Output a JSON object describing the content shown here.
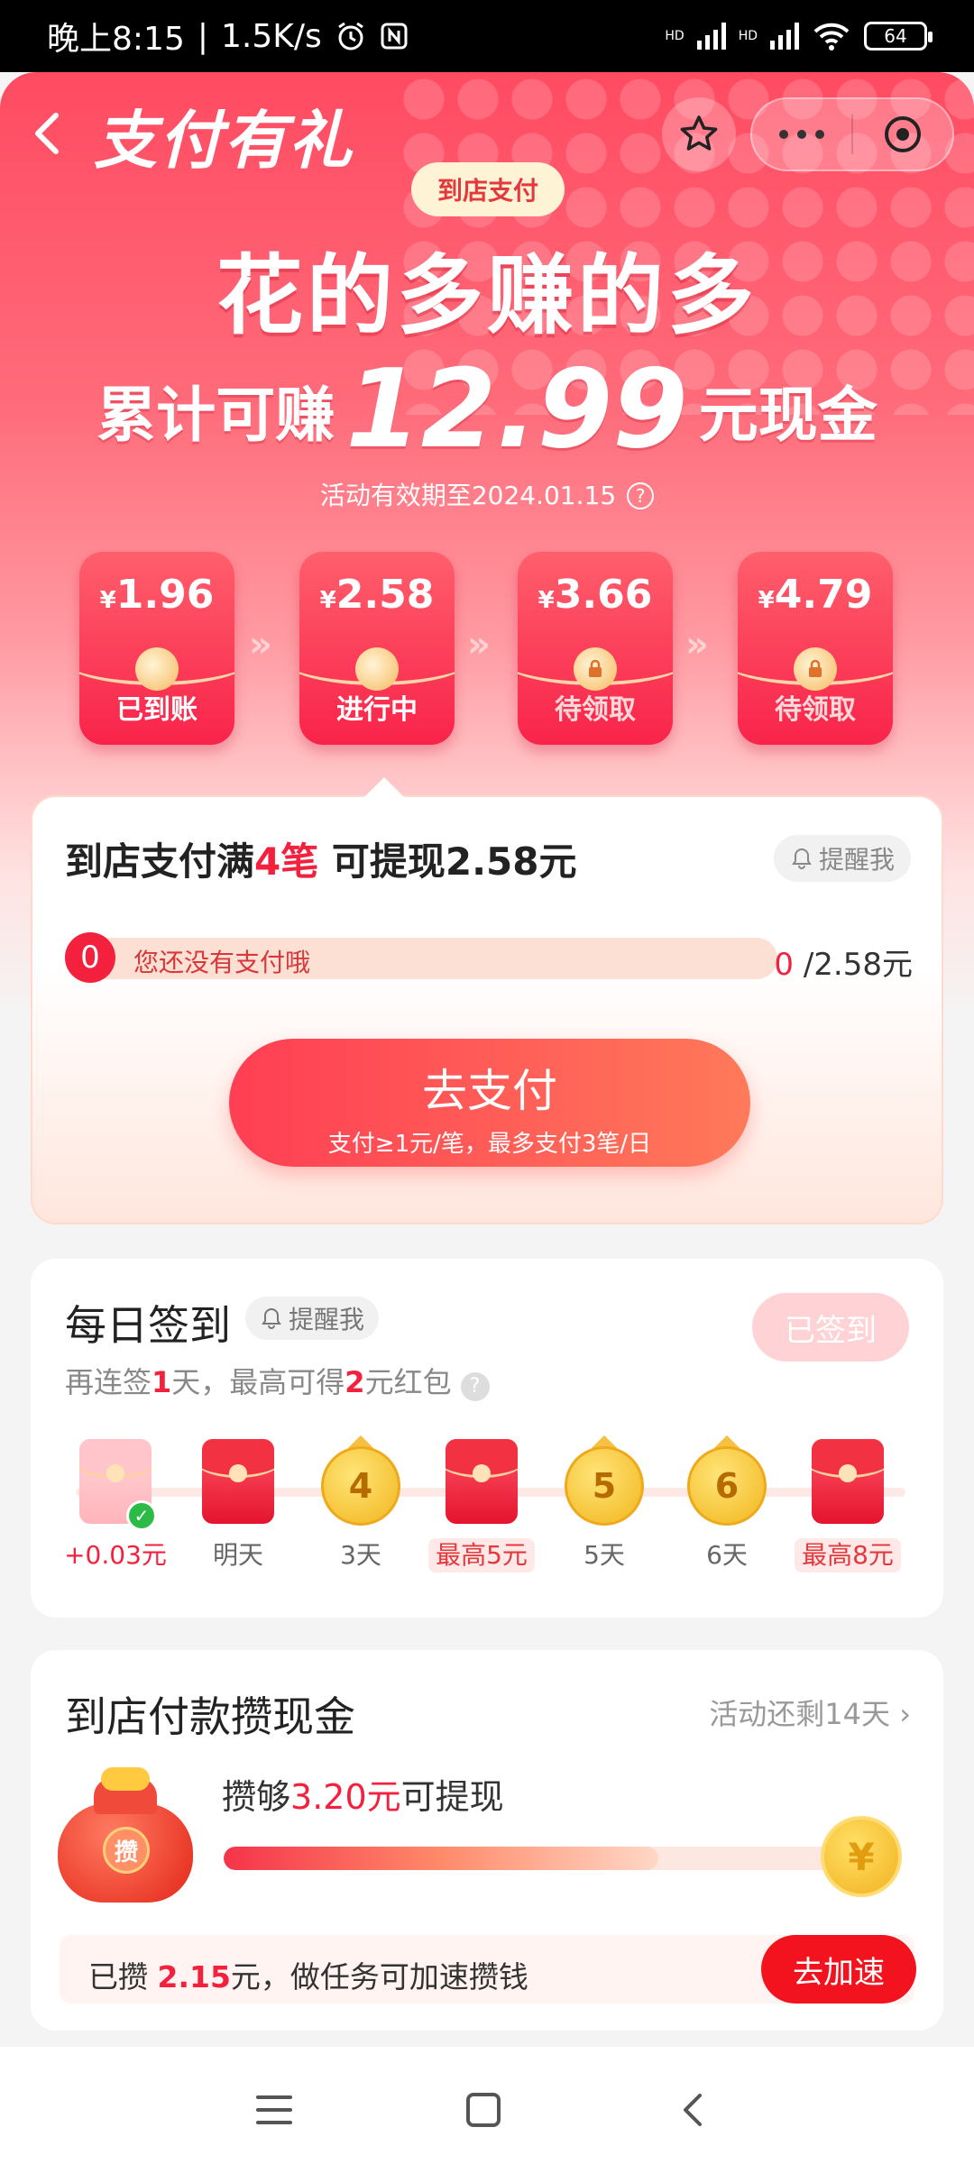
{
  "status_bar": {
    "time": "晚上8:15",
    "separator": "|",
    "speed": "1.5K/s",
    "signal1": "HD",
    "signal2": "HD",
    "battery": "64",
    "icons": [
      "alarm-icon",
      "nfc-icon",
      "signal-icon",
      "wifi-icon",
      "battery-icon"
    ]
  },
  "header": {
    "title": "支付有礼",
    "back_icon": "back-icon",
    "star_icon": "star-icon",
    "more_icon": "more-icon",
    "close_icon": "miniapp-close-icon"
  },
  "hero": {
    "tag": "到店支付",
    "headline": "花的多赚的多",
    "sub_prefix": "累计可赚",
    "sub_amount": "12.99",
    "sub_suffix": "元现金",
    "validity": "活动有效期至2024.01.15",
    "help_icon": "?"
  },
  "envelopes": [
    {
      "currency": "¥",
      "amount": "1.96",
      "status": "已到账",
      "locked": false
    },
    {
      "currency": "¥",
      "amount": "2.58",
      "status": "进行中",
      "locked": false
    },
    {
      "currency": "¥",
      "amount": "3.66",
      "status": "待领取",
      "locked": true
    },
    {
      "currency": "¥",
      "amount": "4.79",
      "status": "待领取",
      "locked": true
    }
  ],
  "task": {
    "title_prefix": "到店支付满",
    "title_count": "4笔",
    "title_suffix": " 可提现2.58元",
    "remind": "提醒我",
    "progress_badge": "0",
    "progress_text": "您还没有支付哦",
    "progress_current": "0",
    "progress_total": " /2.58元",
    "progress_fraction": 0,
    "button_main": "去支付",
    "button_sub": "支付≥1元/笔，最多支付3笔/日"
  },
  "checkin": {
    "title": "每日签到",
    "remind": "提醒我",
    "signed_button": "已签到",
    "sub_prefix": "再连签",
    "sub_days": "1",
    "sub_mid": "天，最高可得",
    "sub_amount": "2",
    "sub_suffix": "元红包",
    "help": "?",
    "days": [
      {
        "type": "redpack-done",
        "label": "+0.03元",
        "style": "red"
      },
      {
        "type": "redpack",
        "label": "明天",
        "style": "plain"
      },
      {
        "type": "coin",
        "number": "4",
        "label": "3天",
        "style": "plain"
      },
      {
        "type": "redpack",
        "label": "最高5元",
        "style": "chip"
      },
      {
        "type": "coin",
        "number": "5",
        "label": "5天",
        "style": "plain"
      },
      {
        "type": "coin",
        "number": "6",
        "label": "6天",
        "style": "plain"
      },
      {
        "type": "redpack",
        "label": "最高8元",
        "style": "chip"
      }
    ]
  },
  "savings": {
    "title": "到店付款攒现金",
    "remaining": "活动还剩14天 ›",
    "bag_mark": "攒",
    "goal_prefix": "攒够",
    "goal_amount": "3.20元",
    "goal_suffix": "可提现",
    "progress_fraction": 0.67,
    "coin_symbol": "¥",
    "footer_prefix": "已攒 ",
    "footer_amount": "2.15",
    "footer_suffix": "元，做任务可加速攒钱",
    "speed_button": "去加速"
  },
  "navbar": {
    "menu_icon": "menu-icon",
    "home_icon": "home-icon",
    "back_icon": "back-icon"
  },
  "colors": {
    "accent_red": "#f3213e",
    "hero_top": "#ff4b62",
    "gold": "#f2b51e"
  }
}
